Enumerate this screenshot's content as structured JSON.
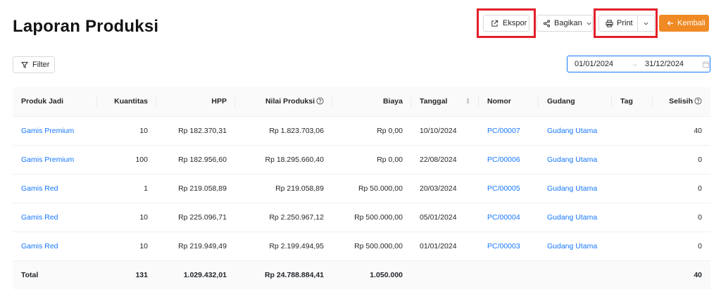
{
  "page": {
    "title": "Laporan Produksi"
  },
  "toolbar": {
    "ekspor_label": "Ekspor",
    "bagikan_label": "Bagikan",
    "print_label": "Print",
    "kembali_label": "Kembali",
    "filter_label": "Filter"
  },
  "date_range": {
    "start": "01/01/2024",
    "arrow": "→",
    "end": "31/12/2024"
  },
  "table": {
    "headers": [
      "Produk Jadi",
      "Kuantitas",
      "HPP",
      "Nilai Produksi",
      "Biaya",
      "Tanggal",
      "Nomor",
      "Gudang",
      "Tag",
      "Selisih"
    ],
    "rows": [
      [
        "Gamis Premium",
        "10",
        "Rp 182.370,31",
        "Rp 1.823.703,06",
        "Rp 0,00",
        "10/10/2024",
        "PC/00007",
        "Gudang Utama",
        "",
        "40"
      ],
      [
        "Gamis Premium",
        "100",
        "Rp 182.956,60",
        "Rp 18.295.660,40",
        "Rp 0,00",
        "22/08/2024",
        "PC/00006",
        "Gudang Utama",
        "",
        "0"
      ],
      [
        "Gamis Red",
        "1",
        "Rp 219.058,89",
        "Rp 219.058,89",
        "Rp 50.000,00",
        "20/03/2024",
        "PC/00005",
        "Gudang Utama",
        "",
        "0"
      ],
      [
        "Gamis Red",
        "10",
        "Rp 225.096,71",
        "Rp 2.250.967,12",
        "Rp 500.000,00",
        "05/01/2024",
        "PC/00004",
        "Gudang Utama",
        "",
        "0"
      ],
      [
        "Gamis Red",
        "10",
        "Rp 219.949,49",
        "Rp 2.199.494,95",
        "Rp 500.000,00",
        "01/01/2024",
        "PC/00003",
        "Gudang Utama",
        "",
        "0"
      ]
    ],
    "total": [
      "Total",
      "131",
      "1.029.432,01",
      "Rp 24.788.884,41",
      "1.050.000",
      "",
      "",
      "",
      "",
      "40"
    ]
  },
  "colors": {
    "accent": "#f08a24",
    "link": "#1677ff",
    "highlight": "#e3202b"
  }
}
